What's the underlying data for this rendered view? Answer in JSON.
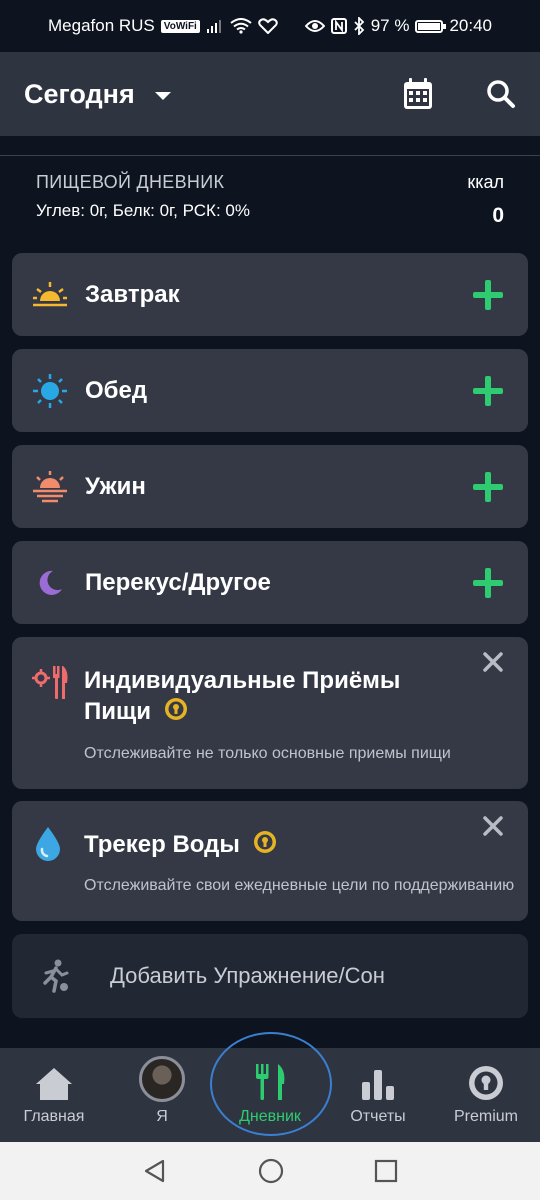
{
  "status_bar": {
    "carrier": "Megafon RUS",
    "vowifi": "VoWiFi",
    "battery": "97 %",
    "time": "20:40"
  },
  "header": {
    "title": "Сегодня"
  },
  "summary": {
    "title": "ПИЩЕВОЙ ДНЕВНИК",
    "macros": "Углев: 0г, Белк: 0г, РСК: 0%",
    "kcal_label": "ккал",
    "kcal_value": "0"
  },
  "meals": [
    {
      "label": "Завтрак",
      "icon": "sunrise-icon"
    },
    {
      "label": "Обед",
      "icon": "sun-icon"
    },
    {
      "label": "Ужин",
      "icon": "sunset-icon"
    },
    {
      "label": "Перекус/Другое",
      "icon": "moon-icon"
    }
  ],
  "promos": [
    {
      "title_line1": "Индивидуальные Приёмы",
      "title_line2": "Пищи",
      "description": "Отслеживайте не только основные приемы пищи",
      "icon": "custom-meals-icon"
    },
    {
      "title": "Трекер Воды",
      "description": "Отслеживайте свои ежедневные цели по поддерживанию",
      "icon": "water-drop-icon"
    }
  ],
  "exercise": {
    "label": "Добавить Упражнение/Сон"
  },
  "bottom_nav": [
    {
      "label": "Главная",
      "icon": "home-icon"
    },
    {
      "label": "Я",
      "icon": "avatar"
    },
    {
      "label": "Дневник",
      "icon": "fork-knife-icon",
      "active": true
    },
    {
      "label": "Отчеты",
      "icon": "bar-chart-icon"
    },
    {
      "label": "Premium",
      "icon": "premium-icon"
    }
  ],
  "colors": {
    "background": "#0d1420",
    "card": "#353946",
    "accent_green": "#2ecc71",
    "premium_gold": "#e6b422"
  }
}
